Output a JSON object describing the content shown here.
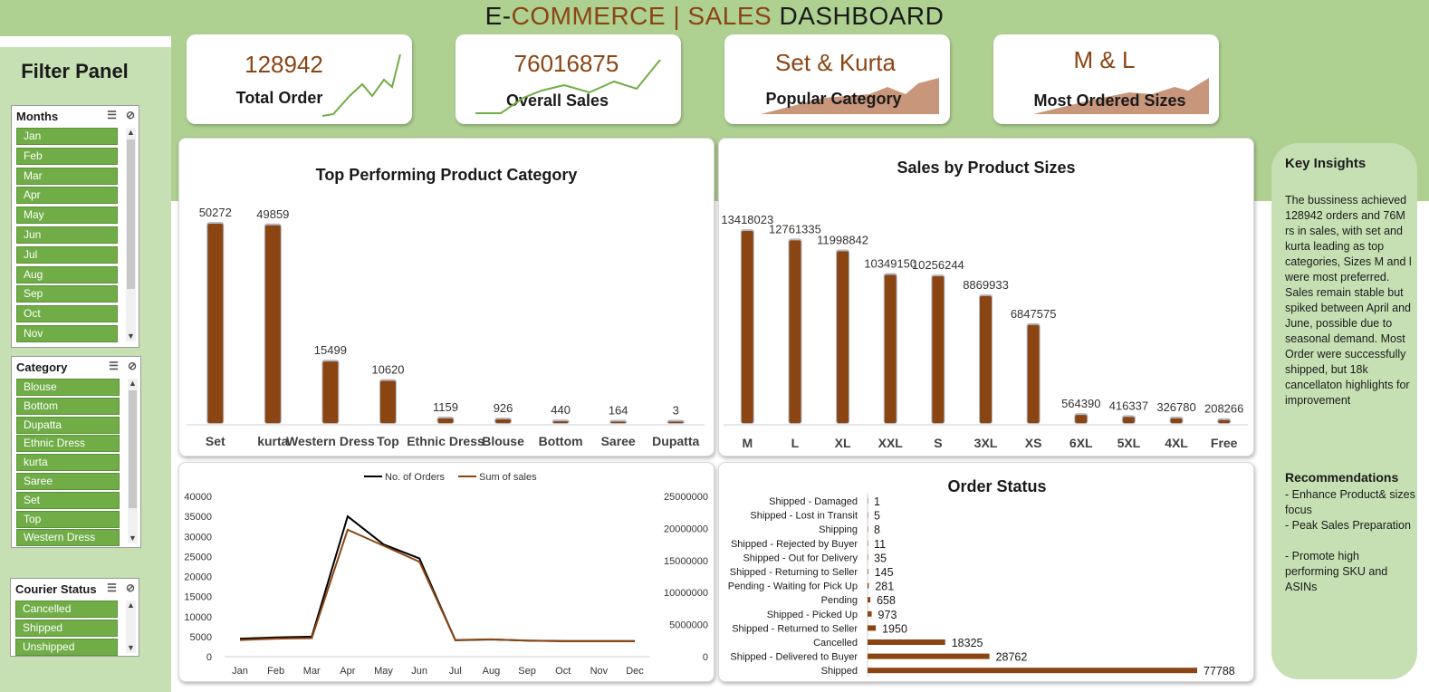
{
  "header": {
    "title_prefix": "E-",
    "title_commerce": "COMMERCE",
    "title_sep": " | ",
    "title_sales": "SALES",
    "title_suffix": " DASHBOARD"
  },
  "filter_panel": {
    "title": "Filter Panel",
    "months": {
      "label": "Months",
      "items": [
        "Jan",
        "Feb",
        "Mar",
        "Apr",
        "May",
        "Jun",
        "Jul",
        "Aug",
        "Sep",
        "Oct",
        "Nov"
      ]
    },
    "category": {
      "label": "Category",
      "items": [
        "Blouse",
        "Bottom",
        "Dupatta",
        "Ethnic Dress",
        "kurta",
        "Saree",
        "Set",
        "Top",
        "Western Dress"
      ]
    },
    "courier": {
      "label": "Courier Status",
      "items": [
        "Cancelled",
        "Shipped",
        "Unshipped"
      ]
    }
  },
  "kpis": [
    {
      "value": "128942",
      "label": "Total Order"
    },
    {
      "value": "76016875",
      "label": "Overall Sales"
    },
    {
      "value": "Set & Kurta",
      "label": "Popular Category"
    },
    {
      "value": "M & L",
      "label": "Most Ordered Sizes"
    }
  ],
  "colors": {
    "brown": "#8b4513",
    "green": "#70ad47",
    "band": "#aed091",
    "light_green": "#c6e0b4",
    "area": "#c8967a"
  },
  "category_chart": {
    "title": "Top Performing Product Category",
    "chart_data": {
      "type": "bar",
      "title": "Top Performing Product Category",
      "categories": [
        "Set",
        "kurta",
        "Western Dress",
        "Top",
        "Ethnic Dress",
        "Blouse",
        "Bottom",
        "Saree",
        "Dupatta"
      ],
      "values": [
        50272,
        49859,
        15499,
        10620,
        1159,
        926,
        440,
        164,
        3
      ]
    }
  },
  "size_chart": {
    "title": "Sales by Product Sizes",
    "chart_data": {
      "type": "bar",
      "title": "Sales by Product Sizes",
      "categories": [
        "M",
        "L",
        "XL",
        "XXL",
        "S",
        "3XL",
        "XS",
        "6XL",
        "5XL",
        "4XL",
        "Free"
      ],
      "values": [
        13418023,
        12761335,
        11998842,
        10349150,
        10256244,
        8869933,
        6847575,
        564390,
        416337,
        326780,
        208266
      ]
    }
  },
  "trend_chart": {
    "chart_data": {
      "type": "line",
      "x": [
        "Jan",
        "Feb",
        "Mar",
        "Apr",
        "May",
        "Jun",
        "Jul",
        "Aug",
        "Sep",
        "Oct",
        "Nov",
        "Dec"
      ],
      "series": [
        {
          "name": "No. of Orders",
          "axis": "left",
          "color": "#000000",
          "values": [
            4500,
            4800,
            5000,
            35000,
            28000,
            24500,
            4100,
            4300,
            4000,
            3900,
            3900,
            3900
          ]
        },
        {
          "name": "Sum of sales",
          "axis": "right",
          "color": "#8b4513",
          "values": [
            2600000,
            2800000,
            2900000,
            19800000,
            17300000,
            14800000,
            2600000,
            2700000,
            2500000,
            2400000,
            2400000,
            2400000
          ]
        }
      ],
      "yticks_left": [
        "40000",
        "35000",
        "30000",
        "25000",
        "20000",
        "15000",
        "10000",
        "5000",
        "0"
      ],
      "yticks_right": [
        "25000000",
        "20000000",
        "15000000",
        "10000000",
        "5000000",
        "0"
      ],
      "ylim_left": [
        0,
        40000
      ],
      "ylim_right": [
        0,
        25000000
      ],
      "legend": "top"
    }
  },
  "status_chart": {
    "title": "Order Status",
    "chart_data": {
      "type": "bar",
      "orientation": "horizontal",
      "title": "Order Status",
      "categories": [
        "Shipped - Damaged",
        "Shipped - Lost in Transit",
        "Shipping",
        "Shipped - Rejected by Buyer",
        "Shipped - Out for Delivery",
        "Shipped - Returning to Seller",
        "Pending - Waiting for Pick Up",
        "Pending",
        "Shipped - Picked Up",
        "Shipped - Returned to Seller",
        "Cancelled",
        "Shipped - Delivered to Buyer",
        "Shipped"
      ],
      "values": [
        1,
        5,
        8,
        11,
        35,
        145,
        281,
        658,
        973,
        1950,
        18325,
        28762,
        77788
      ]
    }
  },
  "insights": {
    "title": "Key Insights",
    "text": "The bussiness achieved 128942 orders and 76M rs in sales, with set and kurta  leading as top categories, Sizes M and l were most preferred. Sales remain stable but spiked between April and June, possible due to seasonal demand. Most Order were successfully shipped, but 18k cancellaton highlights for improvement",
    "rec_title": "Recommendations",
    "recs": [
      "- Enhance Product& sizes  focus",
      "- Peak Sales Preparation",
      "- Promote high performing SKU and ASINs"
    ]
  }
}
